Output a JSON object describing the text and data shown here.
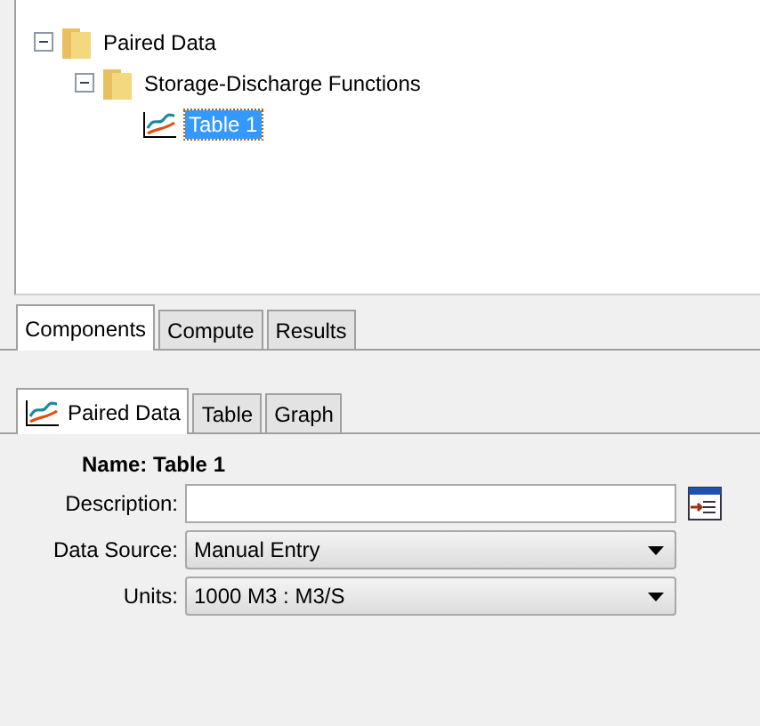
{
  "tree": [
    {
      "label": "Paired Data",
      "kind": "folder",
      "expanded": true,
      "selected": false,
      "children": [
        {
          "label": "Storage-Discharge Functions",
          "kind": "folder",
          "expanded": true,
          "selected": false,
          "children": [
            {
              "label": "Table 1",
              "kind": "table",
              "selected": true
            }
          ]
        }
      ]
    }
  ],
  "top_tabs": [
    {
      "label": "Components",
      "selected": true
    },
    {
      "label": "Compute",
      "selected": false
    },
    {
      "label": "Results",
      "selected": false
    }
  ],
  "bottom_tabs": [
    {
      "label": "Paired Data",
      "icon": true,
      "selected": true
    },
    {
      "label": "Table",
      "selected": false
    },
    {
      "label": "Graph",
      "selected": false
    }
  ],
  "name": {
    "label": "Name:",
    "value": "Table 1"
  },
  "description": {
    "label": "Description:"
  },
  "data_source": {
    "label": "Data Source:",
    "value": "Manual Entry"
  },
  "units": {
    "label": "Units:",
    "value": "1000 M3 : M3/S"
  }
}
